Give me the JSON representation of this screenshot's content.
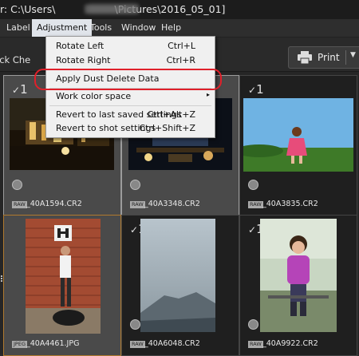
{
  "title_prefix": "r: C:\\Users\\",
  "title_suffix": "\\Pictures\\2016_05_01]",
  "menu": [
    "Label",
    "Adjustment",
    "Tools",
    "Window",
    "Help"
  ],
  "toolbar": {
    "quick_check": "ick Che",
    "print": "Print"
  },
  "dropdown": {
    "items": [
      {
        "label": "Rotate Left",
        "shortcut": "Ctrl+L"
      },
      {
        "label": "Rotate Right",
        "shortcut": "Ctrl+R"
      },
      {
        "label": "Apply Dust Delete Data",
        "shortcut": ""
      },
      {
        "label": "Work color space",
        "shortcut": "▸"
      },
      {
        "label": "Revert to last saved settings",
        "shortcut": "Ctrl+Alt+Z"
      },
      {
        "label": "Revert to shot settings",
        "shortcut": "Ctrl+Shift+Z"
      }
    ]
  },
  "thumbnails": [
    {
      "file": "_40A1594.CR2",
      "type": "RAW",
      "check": "1",
      "selected": true
    },
    {
      "file": "_40A3348.CR2",
      "type": "RAW",
      "check": "1",
      "selected": true
    },
    {
      "file": "_40A3835.CR2",
      "type": "RAW",
      "check": "1",
      "selected": false
    },
    {
      "file": "_40A4461.JPG",
      "type": "JPEG",
      "check": "",
      "selected": true
    },
    {
      "file": "_40A6048.CR2",
      "type": "RAW",
      "check": "1",
      "selected": false
    },
    {
      "file": "_40A9922.CR2",
      "type": "RAW",
      "check": "1",
      "selected": false
    }
  ]
}
